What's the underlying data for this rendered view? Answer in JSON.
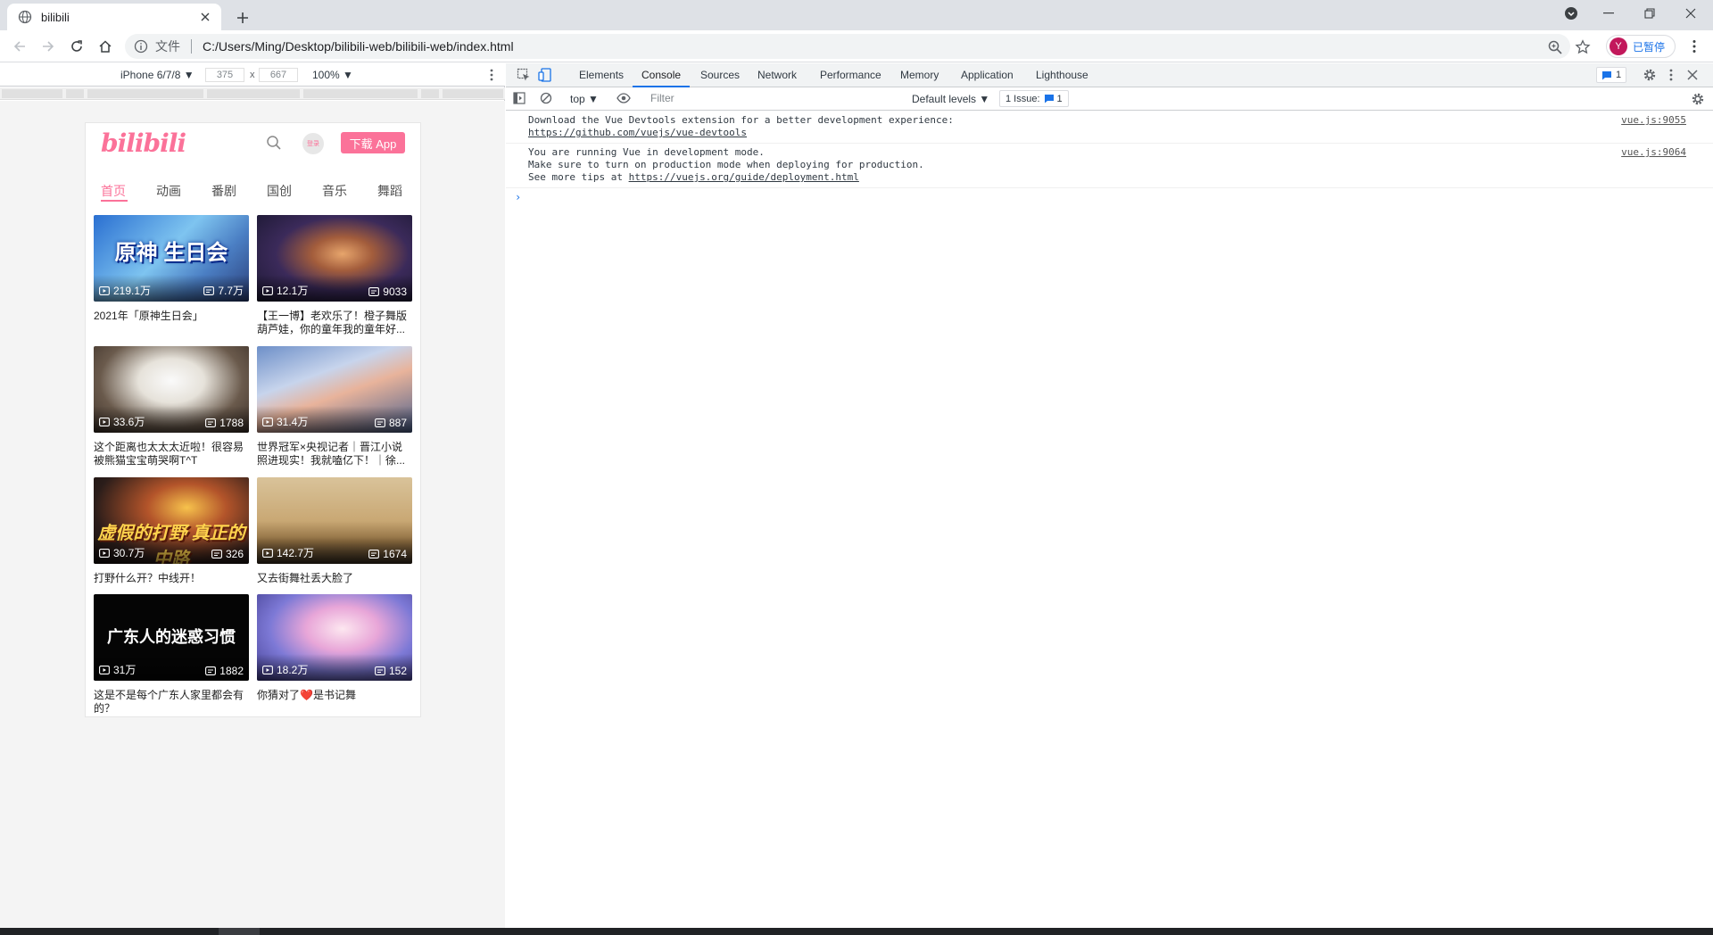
{
  "browser": {
    "tab_title": "bilibili",
    "omnibox_scheme": "文件",
    "url": "C:/Users/Ming/Desktop/bilibili-web/bilibili-web/index.html",
    "profile_initial": "Y",
    "profile_label": "已暂停"
  },
  "device_toolbar": {
    "device": "iPhone 6/7/8 ▼",
    "width": "375",
    "height": "667",
    "times": "x",
    "zoom": "100% ▼"
  },
  "phone": {
    "logo": "bilibili",
    "login_label": "登录",
    "download_label": "下载 App",
    "nav": [
      "首页",
      "动画",
      "番剧",
      "国创",
      "音乐",
      "舞蹈"
    ],
    "videos": [
      {
        "views": "219.1万",
        "danmaku": "7.7万",
        "title": "2021年「原神生日会」",
        "cover_text": "原神 生日会"
      },
      {
        "views": "12.1万",
        "danmaku": "9033",
        "title": "【王一博】老欢乐了！橙子舞版葫芦娃，你的童年我的童年好...",
        "cover_text": ""
      },
      {
        "views": "33.6万",
        "danmaku": "1788",
        "title": "这个距离也太太太近啦！很容易被熊猫宝宝萌哭啊T^T",
        "cover_text": ""
      },
      {
        "views": "31.4万",
        "danmaku": "887",
        "title": "世界冠军×央视记者｜晋江小说照进现实！我就嗑亿下！｜徐...",
        "cover_text": ""
      },
      {
        "views": "30.7万",
        "danmaku": "326",
        "title": "打野什么开？中线开！",
        "cover_text": "虚假的打野 真正的中路"
      },
      {
        "views": "142.7万",
        "danmaku": "1674",
        "title": "又去街舞社丢大脸了",
        "cover_text": ""
      },
      {
        "views": "31万",
        "danmaku": "1882",
        "title": "这是不是每个广东人家里都会有的？",
        "cover_text": "广东人的迷惑习惯"
      },
      {
        "views": "18.2万",
        "danmaku": "152",
        "title": "你猜对了❤️是书记舞",
        "cover_text": ""
      }
    ]
  },
  "devtools": {
    "tabs": [
      "Elements",
      "Console",
      "Sources",
      "Network",
      "Performance",
      "Memory",
      "Application",
      "Lighthouse"
    ],
    "active_tab": "Console",
    "message_badge": "1",
    "context": "top ▼",
    "filter_placeholder": "Filter",
    "levels": "Default levels ▼",
    "issues_label": "1 Issue:",
    "issues_count": "1",
    "messages": [
      {
        "lines": [
          "Download the Vue Devtools extension for a better development experience:"
        ],
        "link": "https://github.com/vuejs/vue-devtools",
        "source": "vue.js:9055"
      },
      {
        "lines": [
          "You are running Vue in development mode.",
          "Make sure to turn on production mode when deploying for production.",
          "See more tips at "
        ],
        "link": "https://vuejs.org/guide/deployment.html",
        "source": "vue.js:9064"
      }
    ],
    "prompt": "›"
  },
  "colors": {
    "bili_pink": "#fb7299",
    "devtools_blue": "#1a73e8"
  }
}
